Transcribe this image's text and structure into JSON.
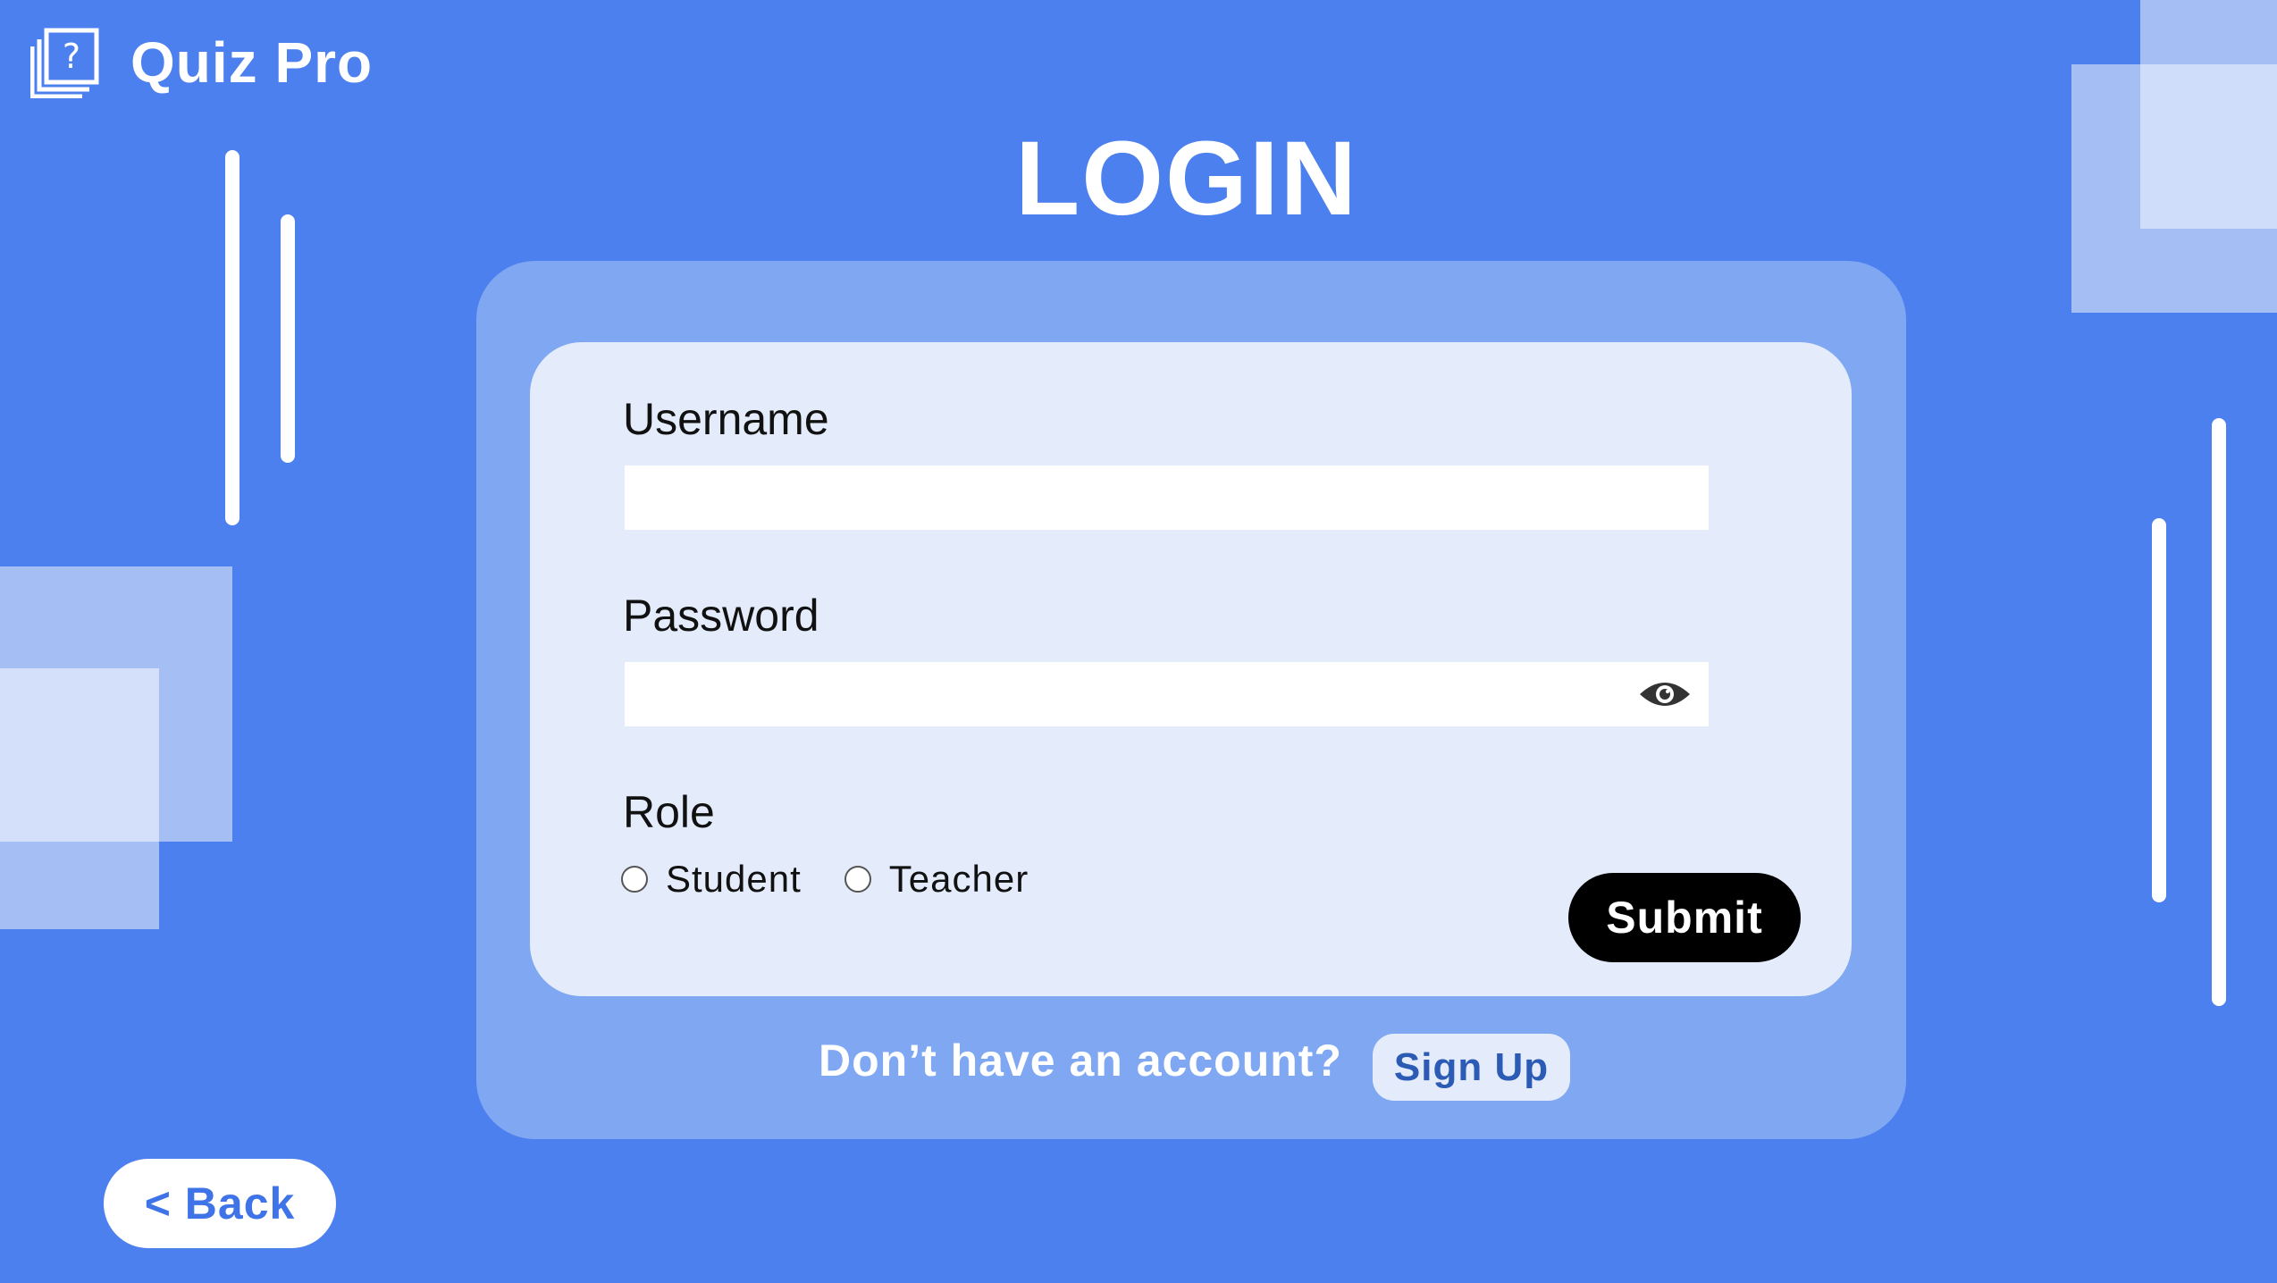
{
  "app": {
    "name": "Quiz Pro",
    "logo_icon": "question-mark-cards-icon"
  },
  "page": {
    "title": "LOGIN"
  },
  "form": {
    "username": {
      "label": "Username",
      "value": "",
      "placeholder": ""
    },
    "password": {
      "label": "Password",
      "value": "",
      "placeholder": "",
      "toggle_icon": "eye-icon"
    },
    "role": {
      "label": "Role",
      "options": [
        {
          "label": "Student",
          "selected": false
        },
        {
          "label": "Teacher",
          "selected": false
        }
      ]
    },
    "submit_label": "Submit"
  },
  "footer": {
    "prompt": "Don’t have an account?",
    "signup_label": "Sign Up"
  },
  "nav": {
    "back_label": "< Back"
  },
  "colors": {
    "background": "#4d80ef",
    "panel": "#7fa7f2",
    "card": "#e4ecfb",
    "submit_bg": "#000000",
    "signup_text": "#2c5bb5",
    "back_text": "#3f74e8"
  }
}
